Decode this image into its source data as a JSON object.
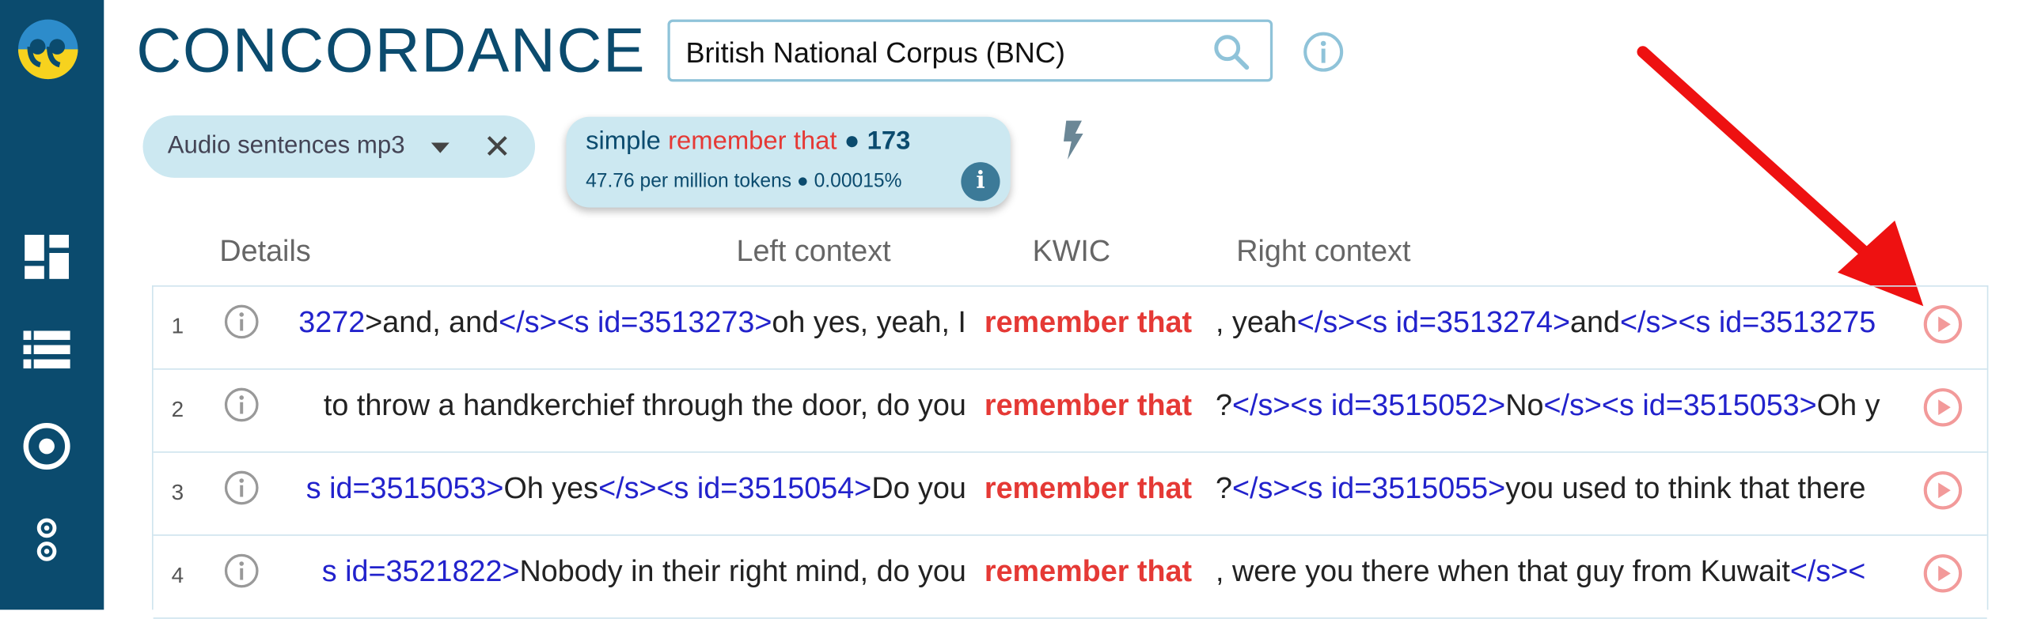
{
  "header": {
    "title": "CONCORDANCE",
    "corpus": "British National Corpus (BNC)"
  },
  "filter_chip": {
    "label": "Audio sentences mp3"
  },
  "result": {
    "mode": "simple",
    "query": "remember that",
    "bullet": "●",
    "count": "173",
    "stats": "47.76 per million tokens ● 0.00015%"
  },
  "columns": {
    "details": "Details",
    "left": "Left context",
    "kwic": "KWIC",
    "right": "Right context"
  },
  "rows": [
    {
      "num": "1",
      "left": [
        [
          "text",
          ">and, and"
        ],
        [
          "tag",
          "</s><s id=3513273>"
        ],
        [
          "text",
          "oh yes, yeah, I"
        ]
      ],
      "left_prefix": "3272",
      "kwic": "remember that",
      "right": [
        [
          "text",
          ", yeah"
        ],
        [
          "tag",
          "</s><s id=3513274>"
        ],
        [
          "text",
          "and"
        ],
        [
          "tag",
          "</s><s id=3513275"
        ]
      ]
    },
    {
      "num": "2",
      "left": [
        [
          "text",
          "to throw a handkerchief through the door, do you"
        ]
      ],
      "left_prefix": "",
      "kwic": "remember that",
      "right": [
        [
          "text",
          "?"
        ],
        [
          "tag",
          "</s><s id=3515052>"
        ],
        [
          "text",
          "No"
        ],
        [
          "tag",
          "</s><s id=3515053>"
        ],
        [
          "text",
          "Oh y"
        ]
      ]
    },
    {
      "num": "3",
      "left": [
        [
          "tag",
          "s id=3515053>"
        ],
        [
          "text",
          "Oh yes"
        ],
        [
          "tag",
          "</s><s id=3515054>"
        ],
        [
          "text",
          "Do you"
        ]
      ],
      "left_prefix": "",
      "kwic": "remember that",
      "right": [
        [
          "text",
          "?"
        ],
        [
          "tag",
          "</s><s id=3515055>"
        ],
        [
          "text",
          "you used to think that there"
        ]
      ]
    },
    {
      "num": "4",
      "left": [
        [
          "tag",
          "s id=3521822>"
        ],
        [
          "text",
          "Nobody in their right mind, do you"
        ]
      ],
      "left_prefix": "",
      "kwic": "remember that",
      "right": [
        [
          "text",
          ", were you there when that guy from Kuwait"
        ],
        [
          "tag",
          "</s><"
        ]
      ]
    }
  ],
  "colors": {
    "sidebar": "#0b4b6e",
    "accent": "#e53935",
    "tag": "#2222cc",
    "chip": "#cce8f1"
  },
  "icons": {
    "logo": "quote-logo-icon",
    "nav": [
      "dashboard-icon",
      "list-icon",
      "target-icon",
      "settings-icon"
    ],
    "search": "search-icon",
    "info": "info-icon",
    "bolt": "lightning-icon",
    "play": "play-icon"
  }
}
